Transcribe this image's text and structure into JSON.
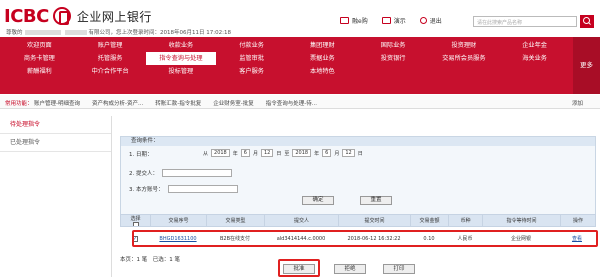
{
  "header": {
    "logo_text": "ICBC",
    "title": "企业网上银行",
    "welcome_prefix": "尊敬的",
    "welcome_mid": "有限公司，您上次登录时间：2018年06月11日 17:02:18",
    "links": [
      "融e购",
      "演示",
      "退出"
    ],
    "search_placeholder": "请在此搜索产品名称"
  },
  "nav": {
    "items": [
      "欢迎页面",
      "账户管理",
      "收款业务",
      "付款业务",
      "集团理财",
      "国际业务",
      "投资理财",
      "企业年金",
      "商务卡管理",
      "托管服务",
      "指令查询与处理",
      "监管审批",
      "票据业务",
      "投资银行",
      "交易所会员服务",
      "海关业务",
      "薪酬福利",
      "中介合作平台",
      "投标管理",
      "客户服务",
      "本地特色",
      "",
      "",
      ""
    ],
    "active_index": 10,
    "more_label": "更多"
  },
  "quick": {
    "label": "常用功能：",
    "items": [
      "账户管理-明细查询",
      "资产构成分析-资产...",
      "转账汇款-指令批复",
      "企业财务室-批复",
      "指令查询与处理-待..."
    ],
    "add_label": "添加"
  },
  "sidebar": {
    "items": [
      "待处理指令",
      "已处理指令"
    ],
    "active_index": 0
  },
  "query": {
    "title": "查询条件：",
    "date_label": "1. 日期：",
    "date_from_prefix": "从",
    "date_to_prefix": "至",
    "from": {
      "year": "2018",
      "month": "6",
      "day": "12"
    },
    "to": {
      "year": "2018",
      "month": "6",
      "day": "12"
    },
    "year_unit": "年",
    "month_unit": "月",
    "day_unit": "日",
    "submitter_label": "2. 提交人：",
    "party_label": "3. 本方账号：",
    "confirm_label": "确定",
    "reset_label": "重置"
  },
  "table": {
    "headers": [
      "选择",
      "交易序号",
      "交易类型",
      "提交人",
      "提交时间",
      "交易金额",
      "币种",
      "指令等待时间",
      "操作"
    ],
    "rows": [
      {
        "seq": "BHGD1631100",
        "type": "B2B在线支付",
        "submitter": "ald3414144.c.0000",
        "time": "2018-06-12 16:32:22",
        "amount": "0.10",
        "currency": "人民币",
        "status": "企业网银",
        "op": "查看"
      }
    ]
  },
  "summary": "本页：1 笔　已选：1 笔",
  "actions": [
    "批准",
    "拒绝",
    "打印"
  ]
}
